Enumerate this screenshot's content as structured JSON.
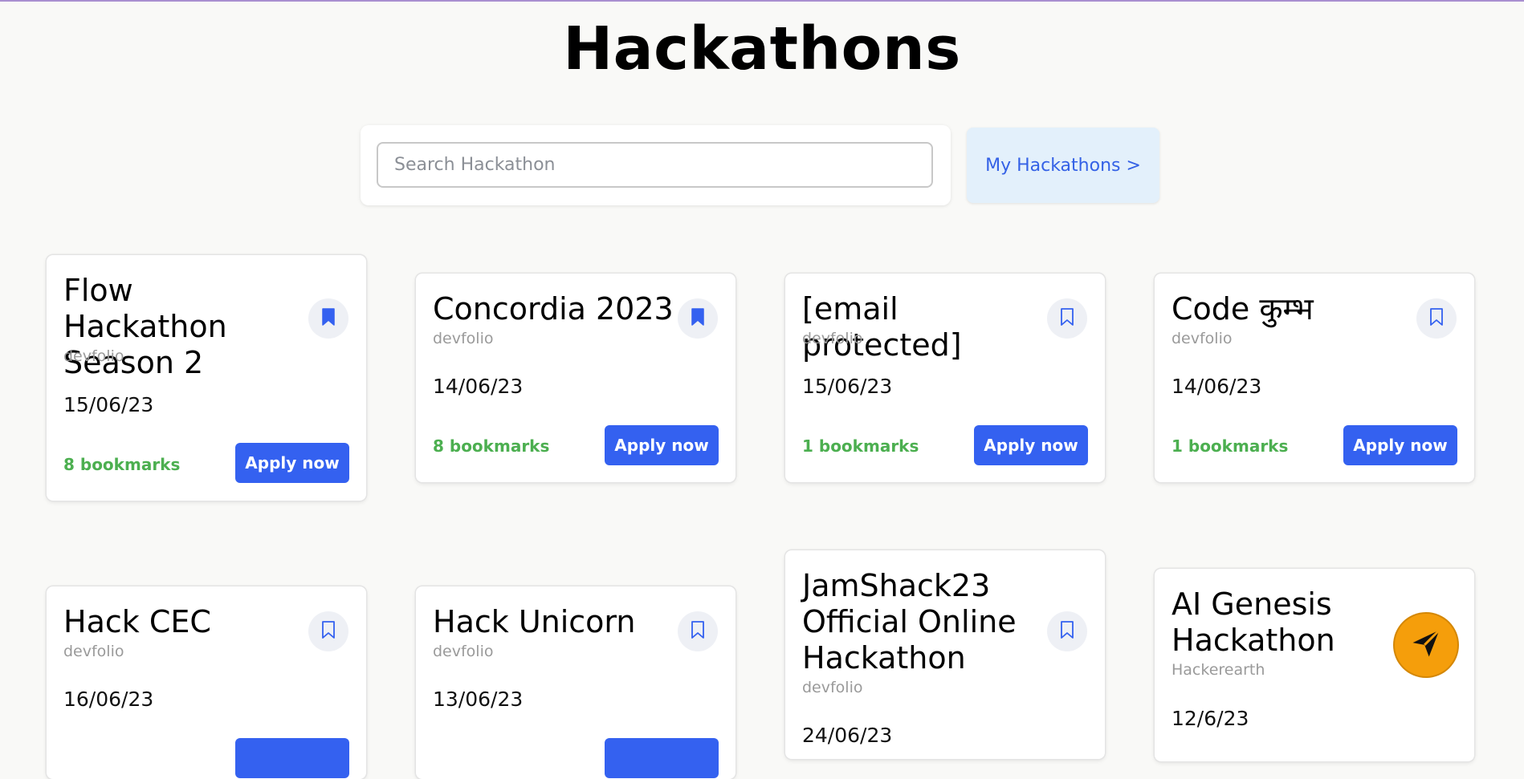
{
  "page": {
    "title": "Hackathons"
  },
  "search": {
    "placeholder": "Search Hackathon",
    "value": ""
  },
  "my_hackathons": {
    "label": "My Hackathons >"
  },
  "cards": [
    {
      "title": "Flow Hackathon\nSeason 2",
      "source": "devfolio",
      "date": "15/06/23",
      "bookmarks": "8 bookmarks",
      "apply_label": "Apply now",
      "bookmarked": true
    },
    {
      "title": "Concordia 2023",
      "source": "devfolio",
      "date": "14/06/23",
      "bookmarks": "8 bookmarks",
      "apply_label": "Apply now",
      "bookmarked": true
    },
    {
      "title": "[email protected]",
      "source": "devfolio",
      "date": "15/06/23",
      "bookmarks": "1 bookmarks",
      "apply_label": "Apply now",
      "bookmarked": false
    },
    {
      "title": "Code कुम्भ",
      "source": "devfolio",
      "date": "14/06/23",
      "bookmarks": "1 bookmarks",
      "apply_label": "Apply now",
      "bookmarked": false
    },
    {
      "title": "Hack CEC",
      "source": "devfolio",
      "date": "16/06/23",
      "bookmarks": "",
      "apply_label": "",
      "bookmarked": false
    },
    {
      "title": "Hack Unicorn",
      "source": "devfolio",
      "date": "13/06/23",
      "bookmarks": "",
      "apply_label": "",
      "bookmarked": false
    },
    {
      "title": "JamShack23\nOfficial Online\nHackathon",
      "source": "devfolio",
      "date": "24/06/23",
      "bookmarks": "",
      "apply_label": "",
      "bookmarked": false
    },
    {
      "title": "AI Genesis\nHackathon",
      "source": "Hackerearth",
      "date": "12/6/23",
      "bookmarks": "",
      "apply_label": "",
      "bookmarked": false
    }
  ],
  "icons": {
    "bookmark_filled": "bookmark-filled-icon",
    "bookmark_outline": "bookmark-outline-icon",
    "send": "send-icon"
  },
  "colors": {
    "accent": "#3461f0",
    "bookmarks_text": "#4caf50",
    "fab": "#f59e0b",
    "my_hackathons_bg": "#e3f0fb"
  }
}
